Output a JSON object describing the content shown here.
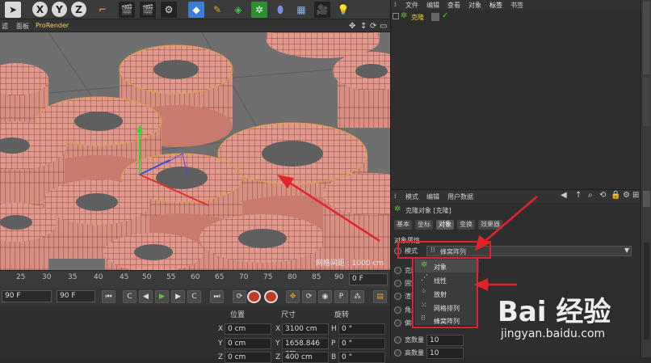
{
  "toolbar": {
    "axis_x": "X",
    "axis_y": "Y",
    "axis_z": "Z",
    "icons": [
      "select-icon",
      "axis-x-icon",
      "axis-y-icon",
      "axis-z-icon",
      "coordinate-system-icon",
      "render-view-icon",
      "render-picture-viewer-icon",
      "render-settings-icon",
      "cube-icon",
      "pen-icon",
      "subdivision-icon",
      "cloner-icon",
      "deformer-icon",
      "floor-icon",
      "camera-icon",
      "light-icon"
    ]
  },
  "viewport_menu": {
    "item1": "滤",
    "item2": "面板",
    "item3": "ProRender"
  },
  "viewport": {
    "grid_readout": "网格间距 : 1000 cm"
  },
  "timeline": {
    "ticks": [
      "25",
      "30",
      "35",
      "40",
      "45",
      "50",
      "55",
      "60",
      "65",
      "70",
      "75",
      "80",
      "85",
      "90"
    ],
    "frame_field": "0 F",
    "end_field_a": "90 F",
    "end_field_b": "90 F"
  },
  "coordinates": {
    "headers": {
      "position": "位置",
      "size": "尺寸",
      "rotation": "旋转"
    },
    "rows": [
      {
        "axis": "X",
        "pos": "0 cm",
        "size": "3100 cm",
        "rot_axis": "H",
        "rot": "0 °"
      },
      {
        "axis": "Y",
        "pos": "0 cm",
        "size": "1658.846 cm",
        "rot_axis": "P",
        "rot": "0 °"
      },
      {
        "axis": "Z",
        "pos": "0 cm",
        "size": "400 cm",
        "rot_axis": "B",
        "rot": "0 °"
      }
    ]
  },
  "object_manager": {
    "menu": [
      "文件",
      "编辑",
      "查看",
      "对象",
      "标签",
      "书签"
    ],
    "object_name": "克隆"
  },
  "attribute_manager": {
    "menu": [
      "模式",
      "编辑",
      "用户数据"
    ],
    "object_title": "克隆对象 [克隆]",
    "tabs": [
      "基本",
      "坐标",
      "对象",
      "变换",
      "效果器"
    ],
    "active_tab": "对象",
    "section": "对象属性",
    "mode_label": "模式",
    "mode_value": "蜂窝阵列",
    "partial_labels": [
      "克隆",
      "固定",
      "渲染",
      "角度",
      "偏移"
    ],
    "width_count_label": "宽数量",
    "width_count_value": "10",
    "height_count_label": "高数量",
    "height_count_value": "10"
  },
  "mode_dropdown": {
    "options": [
      "对象",
      "线性",
      "放射",
      "网格排列",
      "蜂窝阵列"
    ]
  },
  "watermark": {
    "logo": "Bai 经验",
    "url": "jingyan.baidu.com"
  },
  "colors": {
    "torus": "#e2988a",
    "annotation_red": "#e0242a",
    "accent_green": "#5cc43a",
    "viewport_bg": "#6f6f6f"
  }
}
